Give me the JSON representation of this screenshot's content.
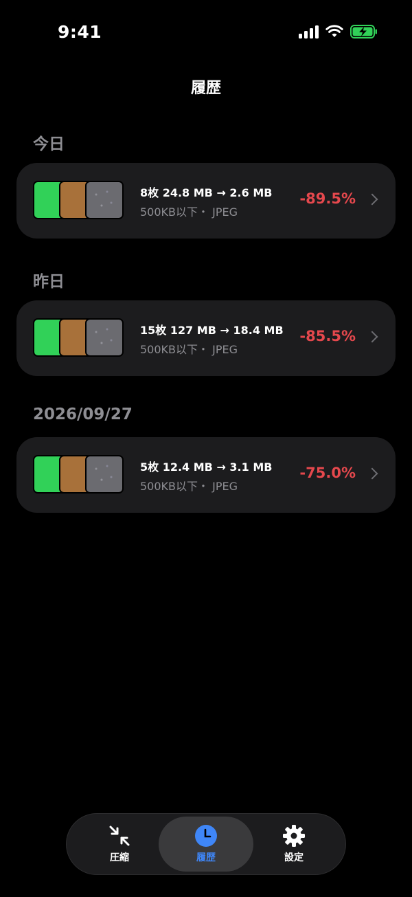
{
  "status_bar": {
    "time": "9:41"
  },
  "nav": {
    "title": "履歴"
  },
  "sections": [
    {
      "header": "今日",
      "entry": {
        "summary": "8枚  24.8 MB → 2.6 MB",
        "detail": "500KB以下・ JPEG",
        "reduction": "-89.5%"
      }
    },
    {
      "header": "昨日",
      "entry": {
        "summary": "15枚  127 MB → 18.4 MB",
        "detail": "500KB以下・ JPEG",
        "reduction": "-85.5%"
      }
    },
    {
      "header": "2026/09/27",
      "entry": {
        "summary": "5枚  12.4 MB → 3.1 MB",
        "detail": "500KB以下・ JPEG",
        "reduction": "-75.0%"
      }
    }
  ],
  "tab_bar": {
    "tabs": [
      {
        "label": "圧縮",
        "icon": "compress-icon",
        "active": false
      },
      {
        "label": "履歴",
        "icon": "clock-icon",
        "active": true
      },
      {
        "label": "設定",
        "icon": "gear-icon",
        "active": false
      }
    ]
  },
  "colors": {
    "background": "#000000",
    "card": "#1c1c1e",
    "reduction": "#e5484d",
    "accent": "#3f86f7",
    "battery": "#31d158"
  }
}
